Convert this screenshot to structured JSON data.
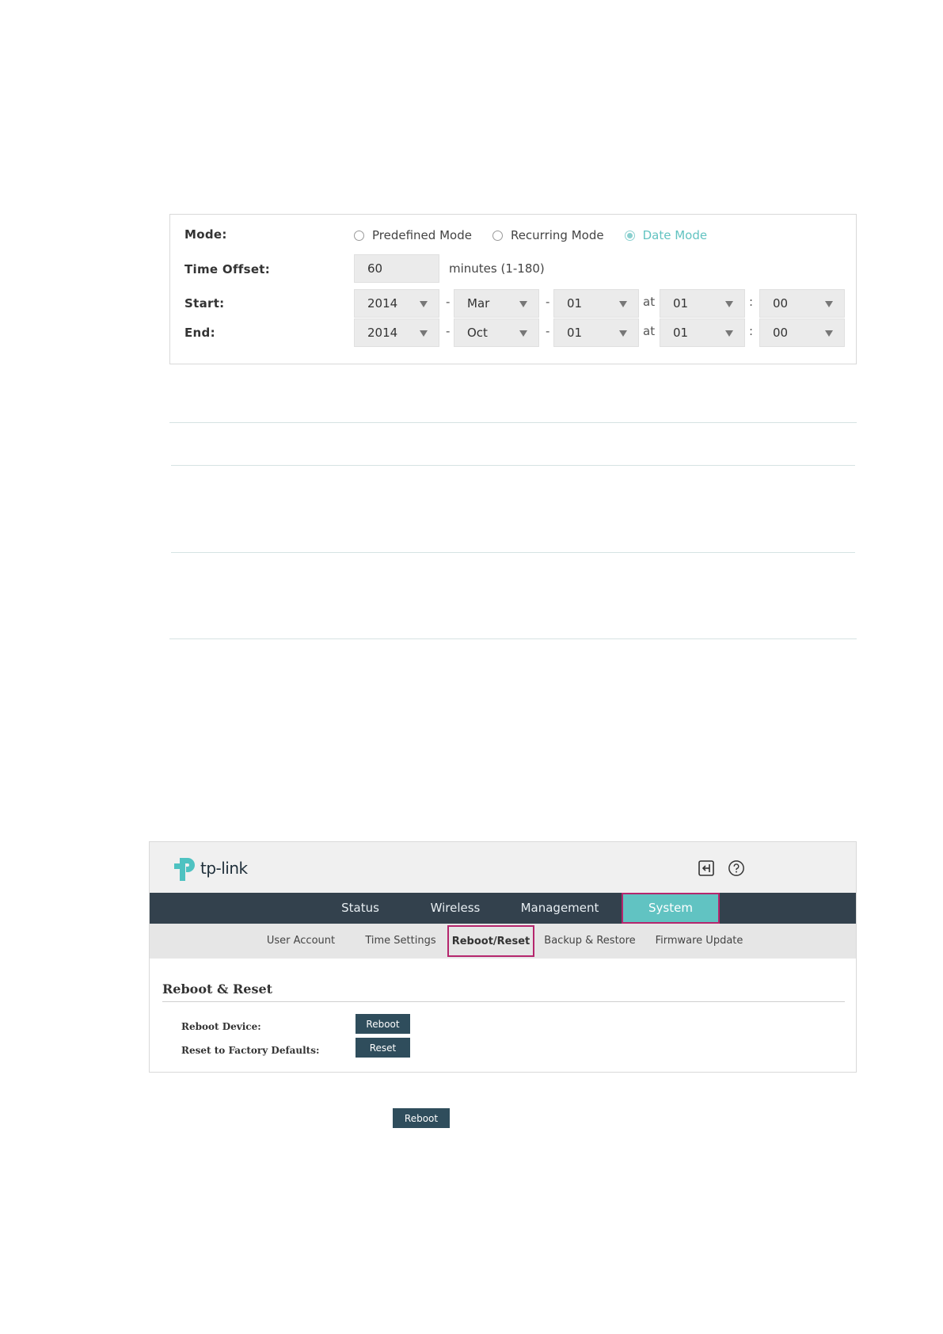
{
  "dst": {
    "mode_label": "Mode:",
    "modes": [
      {
        "label": "Predefined Mode",
        "checked": false
      },
      {
        "label": "Recurring Mode",
        "checked": false
      },
      {
        "label": "Date Mode",
        "checked": true
      }
    ],
    "offset_label": "Time Offset:",
    "offset_value": "60",
    "offset_hint": "minutes (1-180)",
    "start_label": "Start:",
    "end_label": "End:",
    "start": {
      "year": "2014",
      "month": "Mar",
      "day": "01",
      "hour": "01",
      "minute": "00"
    },
    "end": {
      "year": "2014",
      "month": "Oct",
      "day": "01",
      "hour": "01",
      "minute": "00"
    },
    "dash": "-",
    "at": "at",
    "colon": ":"
  },
  "app": {
    "brand": "tp-link",
    "nav": [
      "Status",
      "Wireless",
      "Management",
      "System"
    ],
    "nav_active": "System",
    "subnav": [
      "User Account",
      "Time Settings",
      "Reboot/Reset",
      "Backup & Restore",
      "Firmware Update"
    ],
    "subnav_active": "Reboot/Reset",
    "section_title": "Reboot & Reset",
    "reboot_label": "Reboot Device:",
    "reboot_button": "Reboot",
    "reset_label": "Reset to Factory Defaults:",
    "reset_button": "Reset"
  },
  "standalone_button": "Reboot",
  "colors": {
    "accent": "#61c3c2",
    "nav_bg": "#33414d",
    "button": "#2f4d5c",
    "highlight": "#b5266d"
  }
}
